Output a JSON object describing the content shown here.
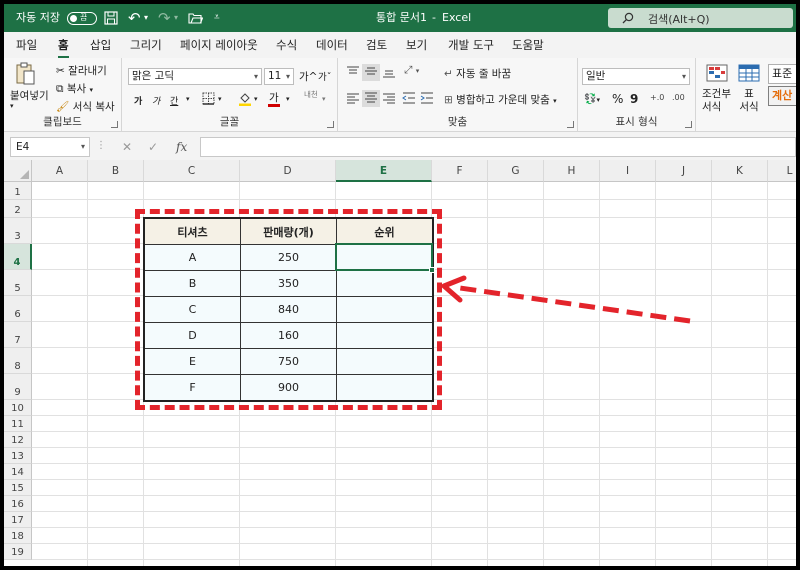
{
  "titlebar": {
    "autosave_label": "자동 저장",
    "autosave_state": "끔",
    "title": "통합 문서1",
    "separator": "-",
    "app": "Excel",
    "search_placeholder": "검색(Alt+Q)"
  },
  "menu": {
    "tabs": [
      "파일",
      "홈",
      "삽입",
      "그리기",
      "페이지 레이아웃",
      "수식",
      "데이터",
      "검토",
      "보기",
      "개발 도구",
      "도움말"
    ],
    "active": "홈"
  },
  "ribbon": {
    "clipboard": {
      "paste": "붙여넣기",
      "cut": "잘라내기",
      "copy": "복사",
      "format_painter": "서식 복사",
      "label": "클립보드"
    },
    "font": {
      "name": "맑은 고딕",
      "size": "11",
      "grow": "가^",
      "shrink": "가ˇ",
      "bold": "가",
      "italic": "가",
      "underline": "간",
      "font_color": "가",
      "phonetic": "내천",
      "label": "글꼴"
    },
    "alignment": {
      "wrap_text": "자동 줄 바꿈",
      "merge_center": "병합하고 가운데 맞춤",
      "label": "맞춤"
    },
    "number": {
      "format": "일반",
      "percent": "%",
      "comma": "9",
      "inc_decimal": "+.0",
      "dec_decimal": ".00",
      "label": "표시 형식"
    },
    "styles": {
      "conditional": "조건부 서식",
      "table": "표 서식",
      "standard": "표준",
      "calculation": "계산"
    }
  },
  "formula_bar": {
    "name_box": "E4",
    "cancel": "✕",
    "enter": "✓",
    "fx": "fx",
    "value": ""
  },
  "grid": {
    "columns": [
      "A",
      "B",
      "C",
      "D",
      "E",
      "F",
      "G",
      "H",
      "I",
      "J",
      "K",
      "L"
    ],
    "rows": [
      "1",
      "2",
      "3",
      "4",
      "5",
      "6",
      "7",
      "8",
      "9",
      "10",
      "11",
      "12",
      "13",
      "14",
      "15",
      "16",
      "17",
      "18",
      "19"
    ],
    "selected_column": "E",
    "selected_row": "4"
  },
  "table": {
    "headers": [
      "티셔츠",
      "판매량(개)",
      "순위"
    ],
    "rows": [
      [
        "A",
        "250",
        ""
      ],
      [
        "B",
        "350",
        ""
      ],
      [
        "C",
        "840",
        ""
      ],
      [
        "D",
        "160",
        ""
      ],
      [
        "E",
        "750",
        ""
      ],
      [
        "F",
        "900",
        ""
      ]
    ]
  },
  "colors": {
    "excel_green": "#1e7145",
    "annotation_red": "#e3242b",
    "table_body": "#f4fbfd",
    "table_header": "#f5f1e6"
  }
}
